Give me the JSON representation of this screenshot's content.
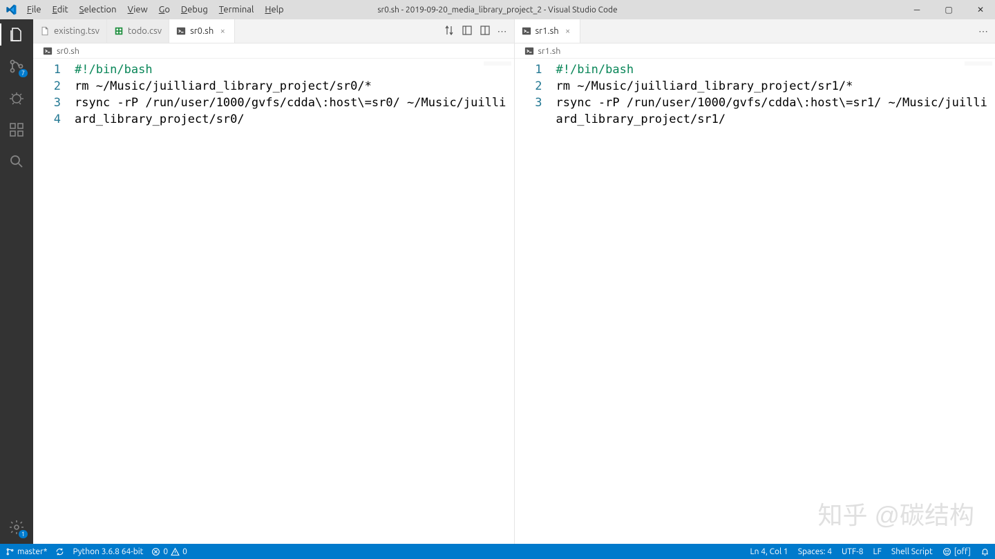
{
  "title": "sr0.sh - 2019-09-20_media_library_project_2 - Visual Studio Code",
  "menu": [
    "File",
    "Edit",
    "Selection",
    "View",
    "Go",
    "Debug",
    "Terminal",
    "Help"
  ],
  "activity": {
    "scm_badge": "7",
    "settings_badge": "1"
  },
  "groups": [
    {
      "tabs": [
        {
          "label": "existing.tsv",
          "icon": "file",
          "active": false,
          "close": false
        },
        {
          "label": "todo.csv",
          "icon": "csv",
          "active": false,
          "close": false
        },
        {
          "label": "sr0.sh",
          "icon": "sh",
          "active": true,
          "close": true
        }
      ],
      "breadcrumb": "sr0.sh",
      "line_numbers": [
        "1",
        "2",
        "3",
        "4"
      ],
      "lines": [
        {
          "t": "#!/bin/bash",
          "cls": "cmt"
        },
        {
          "t": "rm ~/Music/juilliard_library_project/sr0/*",
          "cls": ""
        },
        {
          "t": "rsync -rP /run/user/1000/gvfs/cdda\\:host\\=sr0/ ~/Music/juilliard_library_project/sr0/",
          "cls": ""
        },
        {
          "t": "",
          "cls": ""
        }
      ]
    },
    {
      "tabs": [
        {
          "label": "sr1.sh",
          "icon": "sh",
          "active": true,
          "close": true
        }
      ],
      "breadcrumb": "sr1.sh",
      "line_numbers": [
        "1",
        "2",
        "3"
      ],
      "lines": [
        {
          "t": "#!/bin/bash",
          "cls": "cmt"
        },
        {
          "t": "rm ~/Music/juilliard_library_project/sr1/*",
          "cls": ""
        },
        {
          "t": "rsync -rP /run/user/1000/gvfs/cdda\\:host\\=sr1/ ~/Music/juilliard_library_project/sr1/",
          "cls": ""
        }
      ]
    }
  ],
  "status": {
    "branch": "master*",
    "python": "Python 3.6.8 64-bit",
    "errors": "0",
    "warnings": "0",
    "pos": "Ln 4, Col 1",
    "spaces": "Spaces: 4",
    "encoding": "UTF-8",
    "eol": "LF",
    "lang": "Shell Script",
    "spell": "[off]"
  },
  "watermark": "知乎 @碳结构"
}
